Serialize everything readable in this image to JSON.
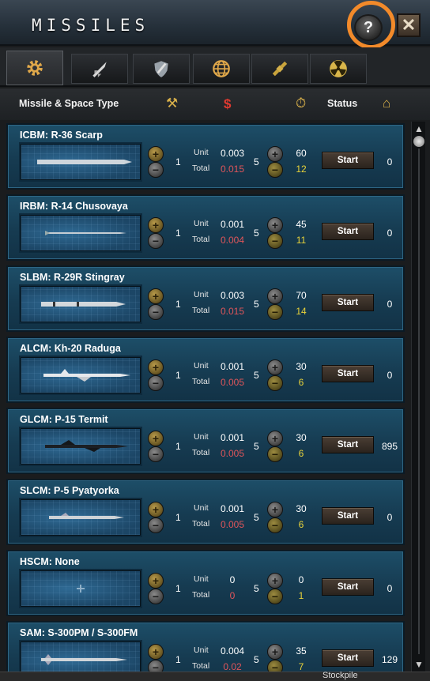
{
  "window": {
    "title": "MISSILES",
    "help_label": "?",
    "close_label": "✕"
  },
  "tabs": [
    {
      "icon": "gear-icon",
      "active": true
    },
    {
      "icon": "rocket-icon",
      "active": false
    },
    {
      "icon": "missile-shield-icon",
      "active": false
    },
    {
      "icon": "globe-icon",
      "active": false
    },
    {
      "icon": "satellite-icon",
      "active": false
    },
    {
      "icon": "radiation-icon",
      "active": false
    }
  ],
  "header": {
    "type_label": "Missile & Space Type",
    "cost_symbol": "$",
    "status_label": "Status"
  },
  "rows": [
    {
      "name": "ICBM: R-36 Scarp",
      "qty": "1",
      "unit_label": "Unit",
      "total_label": "Total",
      "unit_cost": "0.003",
      "total_cost": "0.015",
      "days": "5",
      "capacity": "60",
      "production": "12",
      "start_label": "Start",
      "status": "0",
      "shape": "long"
    },
    {
      "name": "IRBM: R-14 Chusovaya",
      "qty": "1",
      "unit_label": "Unit",
      "total_label": "Total",
      "unit_cost": "0.001",
      "total_cost": "0.004",
      "days": "5",
      "capacity": "45",
      "production": "11",
      "start_label": "Start",
      "status": "0",
      "shape": "thin"
    },
    {
      "name": "SLBM: R-29R Stingray",
      "qty": "1",
      "unit_label": "Unit",
      "total_label": "Total",
      "unit_cost": "0.003",
      "total_cost": "0.015",
      "days": "5",
      "capacity": "70",
      "production": "14",
      "start_label": "Start",
      "status": "0",
      "shape": "slbm"
    },
    {
      "name": "ALCM: Kh-20 Raduga",
      "qty": "1",
      "unit_label": "Unit",
      "total_label": "Total",
      "unit_cost": "0.001",
      "total_cost": "0.005",
      "days": "5",
      "capacity": "30",
      "production": "6",
      "start_label": "Start",
      "status": "0",
      "shape": "jet"
    },
    {
      "name": "GLCM: P-15 Termit",
      "qty": "1",
      "unit_label": "Unit",
      "total_label": "Total",
      "unit_cost": "0.001",
      "total_cost": "0.005",
      "days": "5",
      "capacity": "30",
      "production": "6",
      "start_label": "Start",
      "status": "895",
      "shape": "dark"
    },
    {
      "name": "SLCM: P-5 Pyatyorka",
      "qty": "1",
      "unit_label": "Unit",
      "total_label": "Total",
      "unit_cost": "0.001",
      "total_cost": "0.005",
      "days": "5",
      "capacity": "30",
      "production": "6",
      "start_label": "Start",
      "status": "0",
      "shape": "cruise"
    },
    {
      "name": "HSCM: None",
      "qty": "1",
      "unit_label": "Unit",
      "total_label": "Total",
      "unit_cost": "0",
      "total_cost": "0",
      "days": "5",
      "capacity": "0",
      "production": "1",
      "start_label": "Start",
      "status": "0",
      "shape": "none"
    },
    {
      "name": "SAM: S-300PM / S-300FM",
      "qty": "1",
      "unit_label": "Unit",
      "total_label": "Total",
      "unit_cost": "0.004",
      "total_cost": "0.02",
      "days": "5",
      "capacity": "35",
      "production": "7",
      "start_label": "Start",
      "status": "129",
      "shape": "sam"
    }
  ],
  "footer": {
    "stockpile_label": "Stockpile"
  },
  "colors": {
    "accent_ring": "#f28a2a",
    "cost_red": "#e0555a",
    "production_yellow": "#e8d23a",
    "card_blue": "#1d4e68"
  }
}
